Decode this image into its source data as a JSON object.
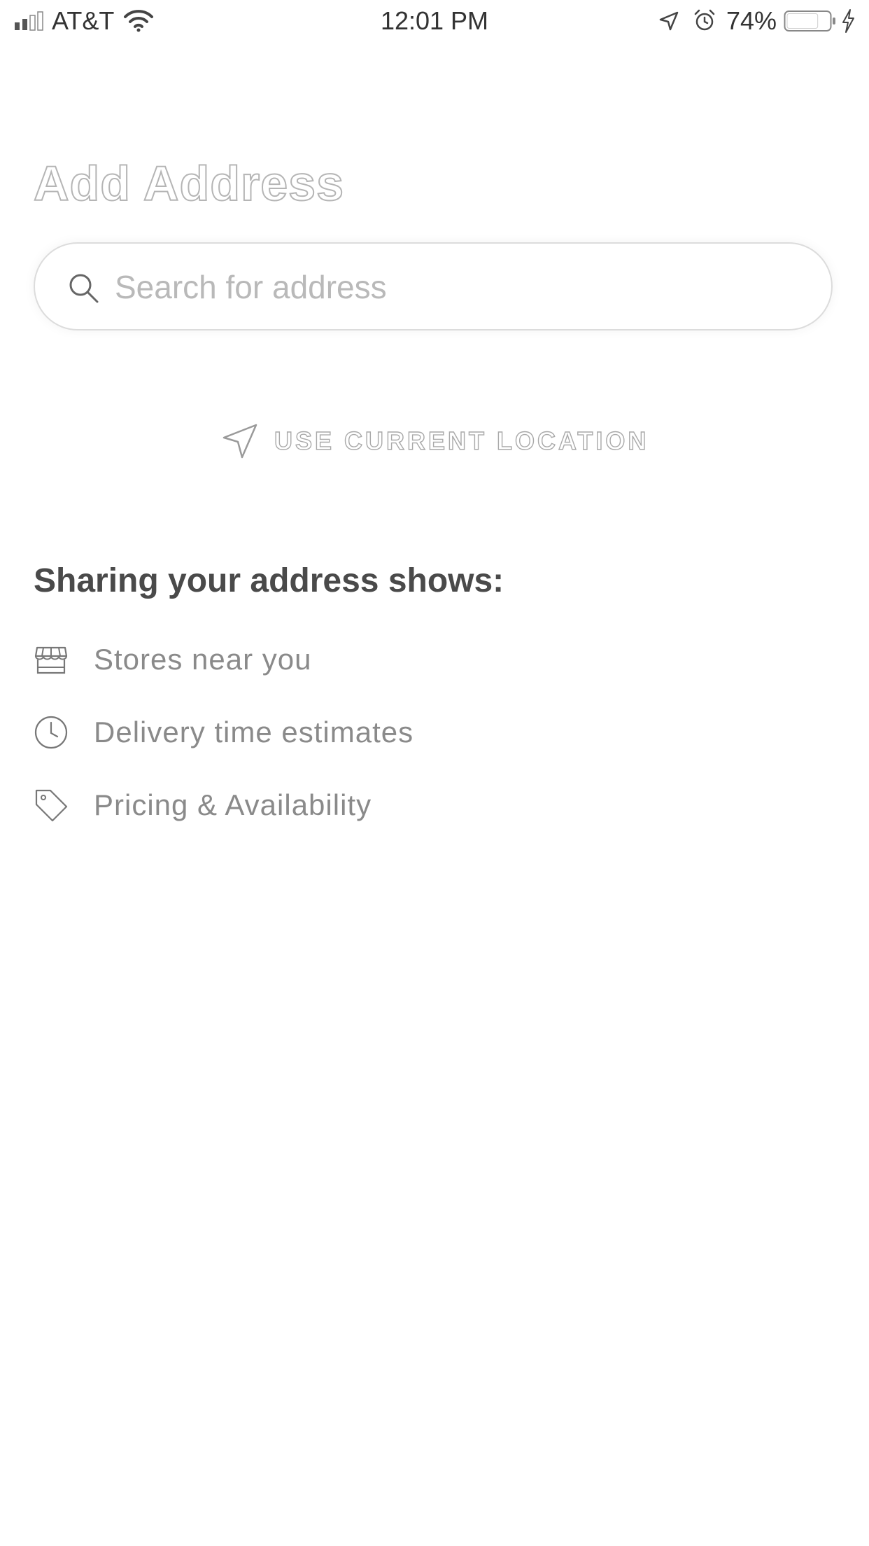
{
  "status_bar": {
    "carrier": "AT&T",
    "time": "12:01 PM",
    "battery_percent": "74%",
    "icons": [
      "signal-icon",
      "wifi-icon",
      "location-arrow-icon",
      "alarm-icon",
      "battery-icon",
      "charging-bolt-icon"
    ],
    "battery_level": 0.74
  },
  "page": {
    "title": "Add Address"
  },
  "search": {
    "placeholder": "Search for address",
    "value": "",
    "icon": "search-icon"
  },
  "location_action": {
    "label": "USE CURRENT LOCATION",
    "icon": "navigation-arrow-icon"
  },
  "info": {
    "heading": "Sharing your address shows:",
    "items": [
      {
        "label": "Stores near you",
        "icon": "store-icon"
      },
      {
        "label": "Delivery time estimates",
        "icon": "clock-icon"
      },
      {
        "label": "Pricing & Availability",
        "icon": "price-tag-icon"
      }
    ]
  },
  "colors": {
    "background": "#ffffff",
    "outline_text": "#b5b5b5",
    "field_border": "#dcdcdc",
    "heading_text": "#4a4a4a",
    "item_text": "#8a8a8a"
  }
}
